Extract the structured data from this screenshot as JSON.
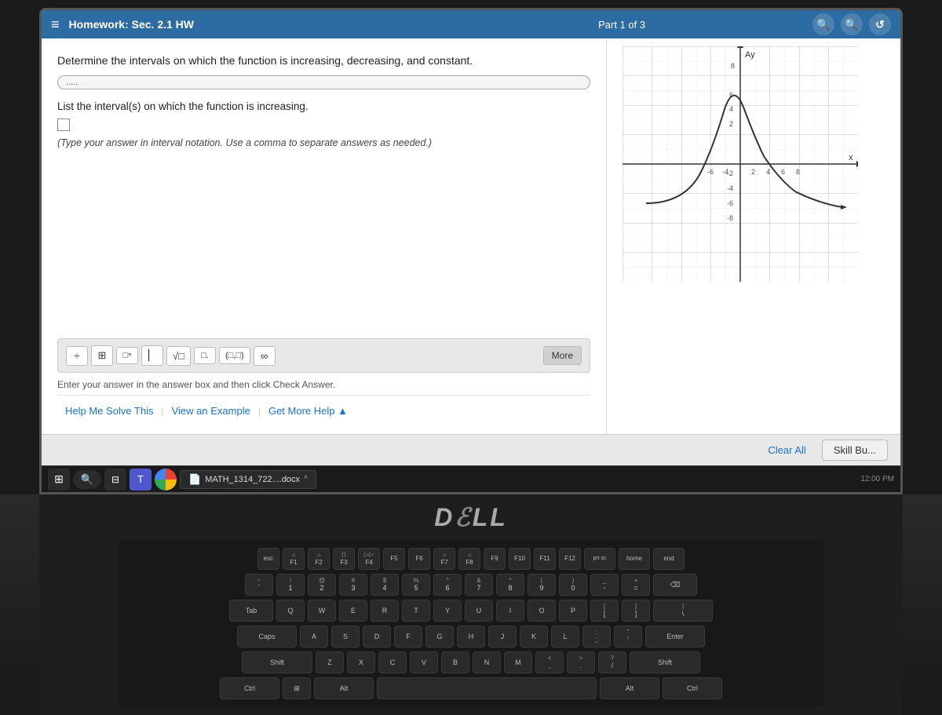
{
  "header": {
    "hamburger": "≡",
    "title": "Homework: Sec. 2.1 HW",
    "part": "Part 1 of 3",
    "icons": [
      "🔍",
      "🔍",
      "↺"
    ]
  },
  "question": {
    "main_text": "Determine the intervals on which the function is increasing, decreasing, and constant.",
    "expand_label": ".....",
    "sub_text": "List the interval(s) on which the function is increasing.",
    "notation_hint": "(Type your answer in interval notation. Use a comma to separate answers as needed.)"
  },
  "math_toolbar": {
    "buttons": [
      "÷",
      "⊞",
      "□ⁿ",
      "▏▎",
      "√□",
      "□.",
      "(□,□)",
      "∞"
    ],
    "more_label": "More"
  },
  "answer": {
    "instruction": "Enter your answer in the answer box and then click Check Answer."
  },
  "actions": {
    "help_me_solve": "Help Me Solve This",
    "view_example": "View an Example",
    "get_more_help": "Get More Help ▲"
  },
  "bottom_bar": {
    "clear_all": "Clear All",
    "skill_builder": "Skill Bu..."
  },
  "taskbar": {
    "doc_label": "MATH_1314_722....docx",
    "win_icon": "⊞",
    "search_icon": "🔍"
  },
  "graph": {
    "x_label": "x",
    "y_label": "Ay",
    "y_max": 8,
    "y_min": -8,
    "x_max": 8,
    "x_min": -8
  },
  "dell_logo": "D",
  "keyboard_rows": [
    [
      "esc",
      "F1",
      "F2",
      "F3",
      "F4",
      "F5",
      "F6",
      "F7",
      "F8",
      "F9",
      "F10",
      "F11",
      "F12",
      "prt sc",
      "home",
      "end"
    ],
    [
      "`~",
      "1!",
      "2@",
      "3#",
      "4$",
      "5%",
      "6^",
      "7&",
      "8*",
      "9(",
      "0)",
      "-_",
      "=+",
      "⌫"
    ],
    [
      "Tab",
      "Q",
      "W",
      "E",
      "R",
      "T",
      "Y",
      "U",
      "I",
      "O",
      "P",
      "[{",
      "]}",
      "\\|"
    ],
    [
      "Caps",
      "A",
      "S",
      "D",
      "F",
      "G",
      "H",
      "J",
      "K",
      "L",
      ";:",
      "'\"",
      "Enter"
    ],
    [
      "Shift",
      "Z",
      "X",
      "C",
      "V",
      "B",
      "N",
      "M",
      ",<",
      ".>",
      "/?",
      "Shift"
    ],
    [
      "Ctrl",
      "Win",
      "Alt",
      "Space",
      "Alt",
      "Ctrl"
    ]
  ]
}
